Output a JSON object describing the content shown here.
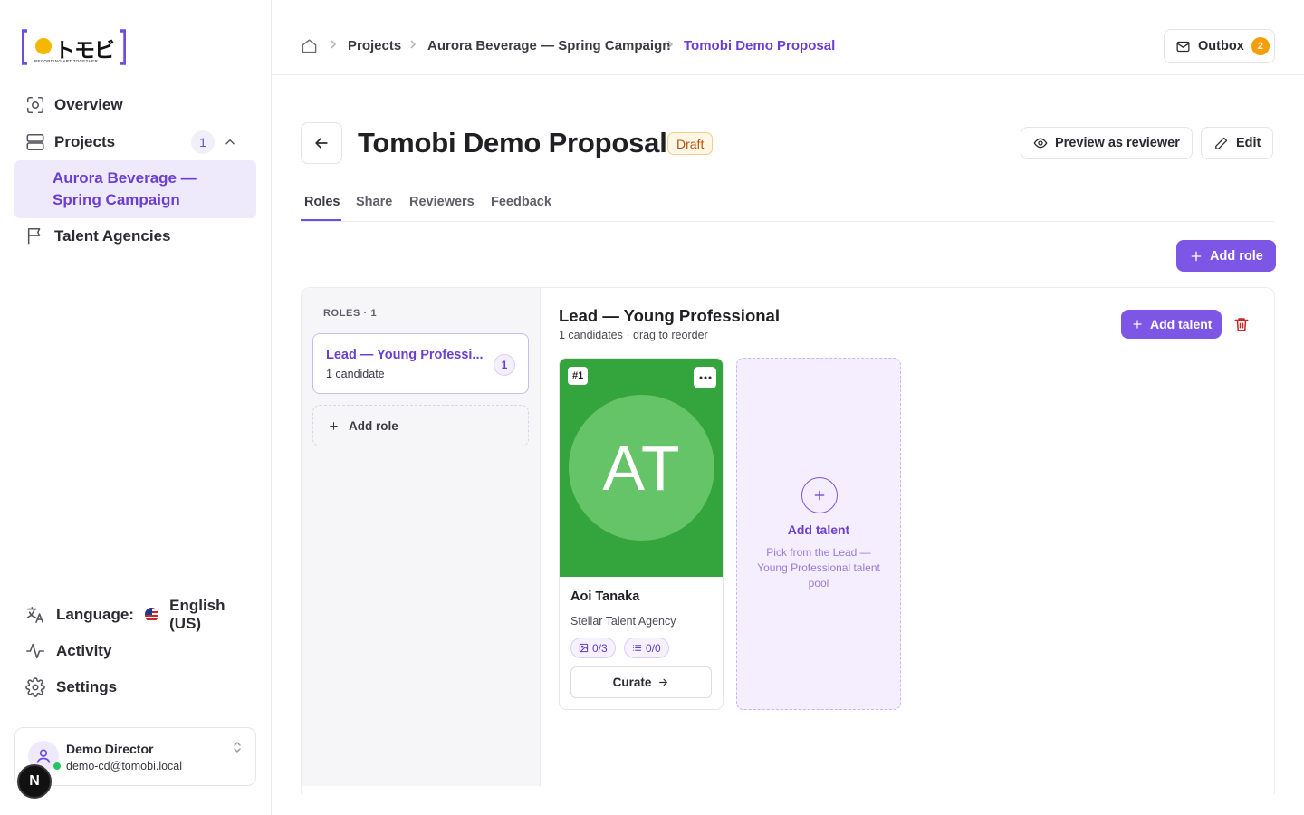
{
  "sidebar": {
    "logo_text": "トモビ",
    "logo_tagline": "RECORDING ART TOGETHER",
    "nav": {
      "overview": "Overview",
      "projects": "Projects",
      "projects_count": "1",
      "active_project": "Aurora Beverage — Spring Campaign",
      "talent_agencies": "Talent Agencies"
    },
    "bottom": {
      "language_label": "Language:",
      "language_value": "English (US)",
      "activity": "Activity",
      "settings": "Settings"
    },
    "user": {
      "name": "Demo Director",
      "email": "demo-cd@tomobi.local"
    },
    "dev_badge": "N"
  },
  "header": {
    "breadcrumbs": [
      "Projects",
      "Aurora Beverage — Spring Campaign",
      "Tomobi Demo Proposal"
    ],
    "outbox_label": "Outbox",
    "outbox_count": "2"
  },
  "page": {
    "title": "Tomobi Demo Proposal",
    "status": "Draft",
    "preview_label": "Preview as reviewer",
    "edit_label": "Edit",
    "tabs": [
      "Roles",
      "Share",
      "Reviewers",
      "Feedback"
    ],
    "active_tab": "Roles",
    "add_role_label": "Add role"
  },
  "roles_panel": {
    "heading": "ROLES · 1",
    "roles": [
      {
        "name": "Lead — Young Professi...",
        "candidates": "1 candidate",
        "count": "1"
      }
    ],
    "add_role_label": "Add role"
  },
  "role_detail": {
    "title": "Lead — Young Professional",
    "subtitle": "1 candidates · drag to reorder",
    "add_talent_label": "Add talent",
    "talents": [
      {
        "rank": "#1",
        "initials": "AT",
        "name": "Aoi Tanaka",
        "agency": "Stellar Talent Agency",
        "photos": "0/3",
        "list": "0/0",
        "curate_label": "Curate",
        "photo_color": "#33a53c"
      }
    ],
    "add_card": {
      "title": "Add talent",
      "description": "Pick from the Lead — Young Professional talent pool"
    }
  },
  "colors": {
    "accent": "#7e56e6",
    "active_text": "#6b3fd4",
    "draft": "#b45309",
    "outbox_badge": "#f59e0b",
    "danger": "#c62828"
  }
}
